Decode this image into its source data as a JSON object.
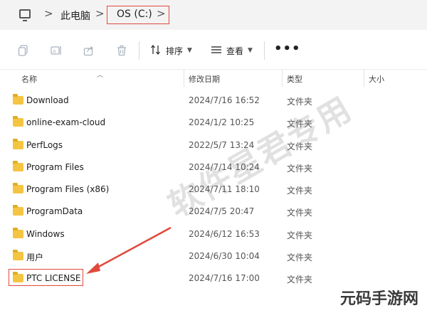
{
  "breadcrumb": {
    "items": [
      "此电脑",
      "OS (C:)"
    ],
    "separator": ">"
  },
  "toolbar": {
    "sort_label": "排序",
    "view_label": "查看",
    "more_label": "•••"
  },
  "columns": {
    "name": "名称",
    "modified": "修改日期",
    "type": "类型",
    "size": "大小"
  },
  "files": [
    {
      "name": "Download",
      "date": "2024/7/16 16:52",
      "type": "文件夹"
    },
    {
      "name": "online-exam-cloud",
      "date": "2024/1/2 10:25",
      "type": "文件夹"
    },
    {
      "name": "PerfLogs",
      "date": "2022/5/7 13:24",
      "type": "文件夹"
    },
    {
      "name": "Program Files",
      "date": "2024/7/14 10:24",
      "type": "文件夹"
    },
    {
      "name": "Program Files (x86)",
      "date": "2024/7/11 18:10",
      "type": "文件夹"
    },
    {
      "name": "ProgramData",
      "date": "2024/7/5 20:47",
      "type": "文件夹"
    },
    {
      "name": "Windows",
      "date": "2024/6/12 16:53",
      "type": "文件夹"
    },
    {
      "name": "用户",
      "date": "2024/6/30 10:04",
      "type": "文件夹"
    },
    {
      "name": "PTC LICENSE",
      "date": "2024/7/16 17:00",
      "type": "文件夹"
    }
  ],
  "watermark": "软件星君专用",
  "corner_logo": "元码手游网",
  "colors": {
    "annotation": "#e04a3c",
    "folder": "#f4c542"
  }
}
